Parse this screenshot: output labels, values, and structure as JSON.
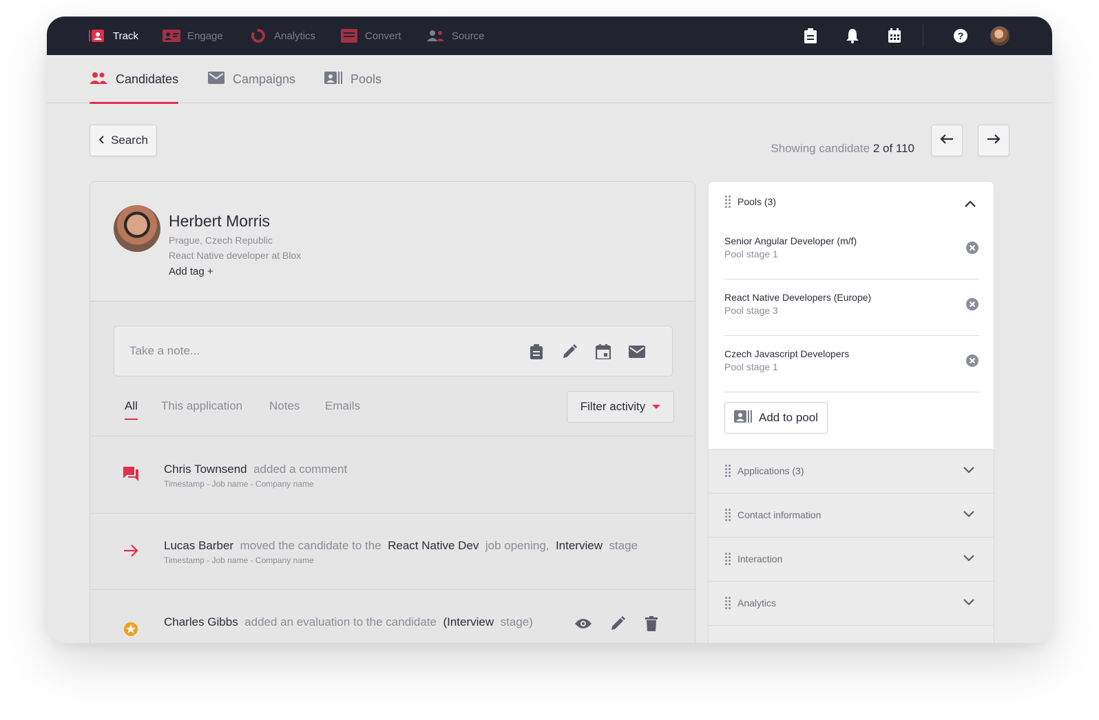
{
  "topnav": {
    "items": [
      {
        "label": "Track",
        "icon": "track-icon"
      },
      {
        "label": "Engage",
        "icon": "engage-icon"
      },
      {
        "label": "Analytics",
        "icon": "analytics-icon"
      },
      {
        "label": "Convert",
        "icon": "convert-icon"
      },
      {
        "label": "Source",
        "icon": "source-icon"
      }
    ],
    "right_icons": [
      "clipboard-icon",
      "bell-icon",
      "calendar-icon",
      "help-icon",
      "user-avatar"
    ]
  },
  "subnav": {
    "tabs": [
      {
        "label": "Candidates",
        "icon": "people-icon"
      },
      {
        "label": "Campaigns",
        "icon": "envelope-icon"
      },
      {
        "label": "Pools",
        "icon": "pool-icon"
      }
    ]
  },
  "toolbar": {
    "back_label": "Search",
    "showing_prefix": "Showing candidate",
    "showing_value": "2 of 110"
  },
  "candidate": {
    "name": "Herbert Morris",
    "location": "Prague, Czech Republic",
    "title": "React Native developer at Blox",
    "add_tag": "Add tag +"
  },
  "note": {
    "placeholder": "Take a note..."
  },
  "activity_tabs": [
    "All",
    "This application",
    "Notes",
    "Emails"
  ],
  "filter_label": "Filter activity",
  "activities": [
    {
      "icon": "comment-icon",
      "parts": [
        {
          "text": "Chris Townsend",
          "strong": true
        },
        {
          "text": "added a comment",
          "strong": false
        }
      ],
      "meta": "Timestamp -  Job name - Company name"
    },
    {
      "icon": "arrow-right-icon",
      "parts": [
        {
          "text": "Lucas Barber",
          "strong": true
        },
        {
          "text": "moved the candidate to the",
          "strong": false
        },
        {
          "text": "React Native Dev",
          "strong": true
        },
        {
          "text": "job opening,",
          "strong": false
        },
        {
          "text": "Interview",
          "strong": true
        },
        {
          "text": "stage",
          "strong": false
        }
      ],
      "meta": "Timestamp -  Job name - Company name"
    },
    {
      "icon": "star-badge-icon",
      "parts": [
        {
          "text": "Charles Gibbs",
          "strong": true
        },
        {
          "text": "added an evaluation to the candidate",
          "strong": false
        },
        {
          "text": "(Interview",
          "strong": true
        },
        {
          "text": "stage)",
          "strong": false
        }
      ],
      "meta": ""
    }
  ],
  "pools": {
    "header": "Pools (3)",
    "items": [
      {
        "name": "Senior Angular Developer (m/f)",
        "stage": "Pool stage 1"
      },
      {
        "name": "React Native Developers (Europe)",
        "stage": "Pool stage 3"
      },
      {
        "name": "Czech Javascript Developers",
        "stage": "Pool stage 1"
      }
    ],
    "add_label": "Add to pool"
  },
  "accordions": [
    "Applications (3)",
    "Contact information",
    "Interaction",
    "Analytics"
  ],
  "colors": {
    "accent": "#e0304a",
    "nav_bg": "#21232f",
    "page_bg": "#e8e8e9"
  }
}
